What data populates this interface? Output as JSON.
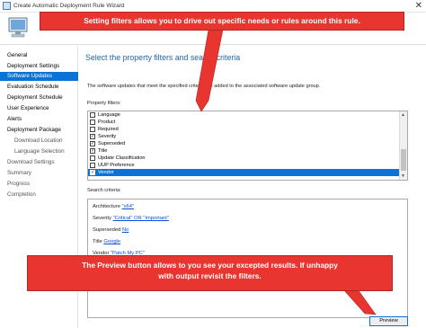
{
  "window": {
    "title": "Create Automatic Deployment Rule Wizard",
    "close_glyph": "✕"
  },
  "sidebar": {
    "items": [
      {
        "label": "General",
        "active": false,
        "sub": false
      },
      {
        "label": "Deployment Settings",
        "active": false,
        "sub": false
      },
      {
        "label": "Software Updates",
        "active": true,
        "sub": false
      },
      {
        "label": "Evaluation Schedule",
        "active": false,
        "sub": false
      },
      {
        "label": "Deployment Schedule",
        "active": false,
        "sub": false
      },
      {
        "label": "User Experience",
        "active": false,
        "sub": false
      },
      {
        "label": "Alerts",
        "active": false,
        "sub": false
      },
      {
        "label": "Deployment Package",
        "active": false,
        "sub": false
      },
      {
        "label": "Download Location",
        "active": false,
        "sub": true
      },
      {
        "label": "Language Selection",
        "active": false,
        "sub": true
      },
      {
        "label": "Download Settings",
        "active": false,
        "sub": false,
        "dim": true
      },
      {
        "label": "Summary",
        "active": false,
        "sub": false,
        "dim": true
      },
      {
        "label": "Progress",
        "active": false,
        "sub": false,
        "dim": true
      },
      {
        "label": "Completion",
        "active": false,
        "sub": false,
        "dim": true
      }
    ]
  },
  "main": {
    "title": "Select the property filters and search criteria",
    "description": "The software updates that meet the specified criteria are added to the associated software update group.",
    "property_filters_label": "Property filters:",
    "property_filters": [
      {
        "label": "Language",
        "checked": false,
        "selected": false
      },
      {
        "label": "Product",
        "checked": false,
        "selected": false
      },
      {
        "label": "Required",
        "checked": false,
        "selected": false
      },
      {
        "label": "Severity",
        "checked": true,
        "selected": false
      },
      {
        "label": "Superseded",
        "checked": true,
        "selected": false
      },
      {
        "label": "Title",
        "checked": true,
        "selected": false
      },
      {
        "label": "Update Classification",
        "checked": false,
        "selected": false
      },
      {
        "label": "UUP Preference",
        "checked": false,
        "selected": false
      },
      {
        "label": "Vendor",
        "checked": true,
        "selected": true
      }
    ],
    "search_criteria_label": "Search criteria:",
    "criteria": [
      {
        "prefix": "Architecture ",
        "value": "\"x64\""
      },
      {
        "prefix": "Severity ",
        "value": "\"Critical\" OR \"Important\""
      },
      {
        "prefix": "Superseded ",
        "value": "No"
      },
      {
        "prefix": "Title ",
        "value": "Google"
      },
      {
        "prefix": "Vendor ",
        "value": "\"Patch My PC\""
      }
    ],
    "preview_label": "Preview"
  },
  "callouts": {
    "top": "Setting filters allows you to drive out specific needs or rules around this rule.",
    "bottom_line1": "The Preview button allows to you see your excepted results. If unhappy",
    "bottom_line2": "with output revisit the filters."
  },
  "colors": {
    "accent": "#0b73d8",
    "callout_red": "#e8352f",
    "title_blue": "#2266aa",
    "link_blue": "#0b4fd8"
  }
}
